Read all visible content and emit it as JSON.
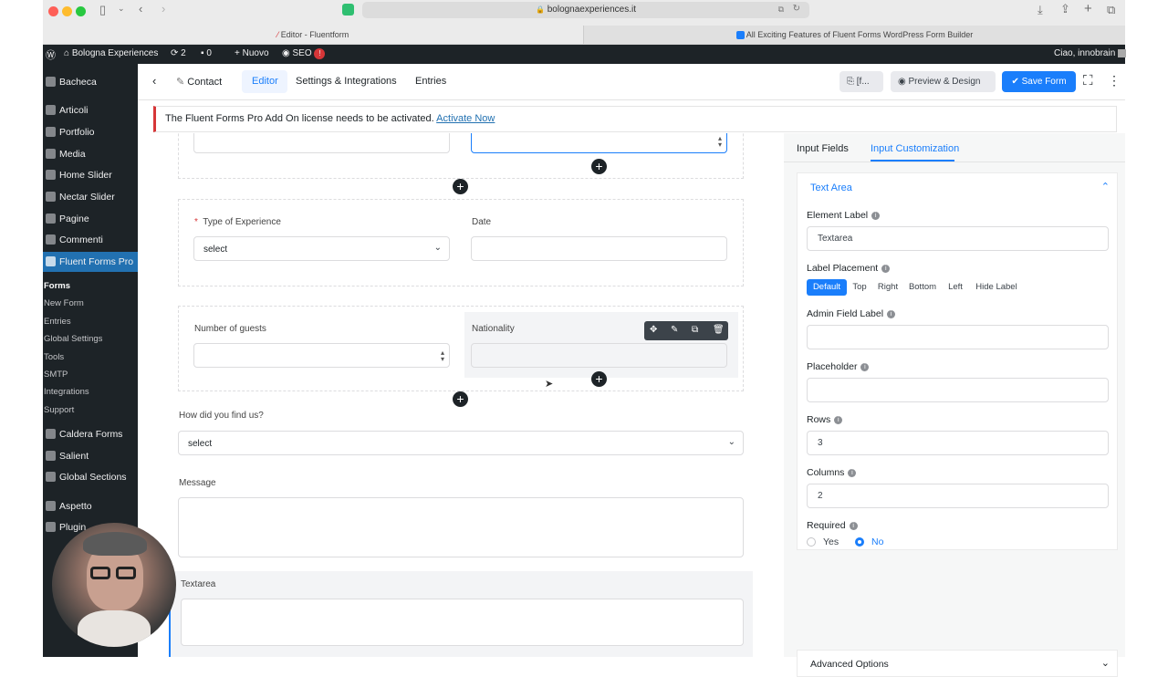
{
  "browser": {
    "url": "bolognaexperiences.it",
    "tabs": [
      "Editor - Fluentform",
      "All Exciting Features of Fluent Forms WordPress Form Builder"
    ]
  },
  "adminbar": {
    "site": "Bologna Experiences",
    "updates": "2",
    "comments": "0",
    "new": "Nuovo",
    "seo": "SEO",
    "seo_badge": "!",
    "greeting": "Ciao, innobrain"
  },
  "sidebar": {
    "items": [
      "Bacheca",
      "Articoli",
      "Portfolio",
      "Media",
      "Home Slider",
      "Nectar Slider",
      "Pagine",
      "Commenti"
    ],
    "active": "Fluent Forms Pro",
    "submenu": [
      "Forms",
      "New Form",
      "Entries",
      "Global Settings",
      "Tools",
      "SMTP",
      "Integrations",
      "Support"
    ],
    "items2": [
      "Caldera Forms",
      "Salient",
      "Global Sections"
    ],
    "items3": [
      "Aspetto",
      "Plugin"
    ]
  },
  "topnav": {
    "form_name": "Contact",
    "tabs": [
      "Editor",
      "Settings & Integrations",
      "Entries"
    ],
    "shortcode_label": "[f...",
    "preview_label": "Preview & Design",
    "save_label": "Save Form"
  },
  "notice": {
    "text": "The Fluent Forms Pro Add On license needs to be activated.",
    "link": "Activate Now"
  },
  "form": {
    "type_label": "Type of Experience",
    "type_value": "select",
    "date_label": "Date",
    "guests_label": "Number of guests",
    "nationality_label": "Nationality",
    "find_label": "How did you find us?",
    "find_value": "select",
    "message_label": "Message",
    "textarea_label": "Textarea"
  },
  "panel": {
    "tabs": [
      "Input Fields",
      "Input Customization"
    ],
    "section_title": "Text Area",
    "element_label": "Element Label",
    "element_value": "Textarea",
    "placement_label": "Label Placement",
    "placement_options": [
      "Default",
      "Top",
      "Right",
      "Bottom",
      "Left",
      "Hide Label"
    ],
    "admin_label": "Admin Field Label",
    "placeholder_label": "Placeholder",
    "rows_label": "Rows",
    "rows_value": "3",
    "cols_label": "Columns",
    "cols_value": "2",
    "required_label": "Required",
    "required_yes": "Yes",
    "required_no": "No",
    "advanced": "Advanced Options"
  }
}
